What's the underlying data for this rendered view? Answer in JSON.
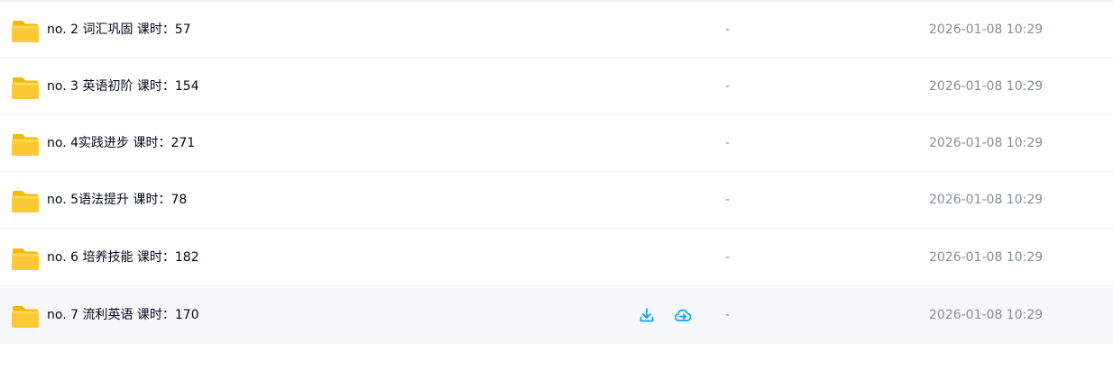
{
  "files": [
    {
      "name": "no. 2 词汇巩固 课时：57",
      "size": "-",
      "date": "2026-01-08 10:29",
      "icon": "folder-icon"
    },
    {
      "name": "no. 3 英语初阶 课时：154",
      "size": "-",
      "date": "2026-01-08 10:29",
      "icon": "folder-icon"
    },
    {
      "name": "no. 4实践进步 课时：271",
      "size": "-",
      "date": "2026-01-08 10:29",
      "icon": "folder-icon"
    },
    {
      "name": "no. 5语法提升 课时：78",
      "size": "-",
      "date": "2026-01-08 10:29",
      "icon": "folder-icon"
    },
    {
      "name": "no. 6 培养技能 课时：182",
      "size": "-",
      "date": "2026-01-08 10:29",
      "icon": "folder-icon"
    },
    {
      "name": "no. 7 流利英语 课时：170",
      "size": "-",
      "date": "2026-01-08 10:29",
      "icon": "folder-icon"
    }
  ],
  "hovered_row_actions": [
    {
      "icon": "download-icon"
    },
    {
      "icon": "cloud-save-icon"
    }
  ],
  "colors": {
    "folder": "#fcc936",
    "folder_light": "#ffd85a",
    "accent": "#06a7ff",
    "text": "#03081a",
    "muted": "#878c9c",
    "hover_bg": "#f7f8fb",
    "divider": "#f0f1f4"
  }
}
